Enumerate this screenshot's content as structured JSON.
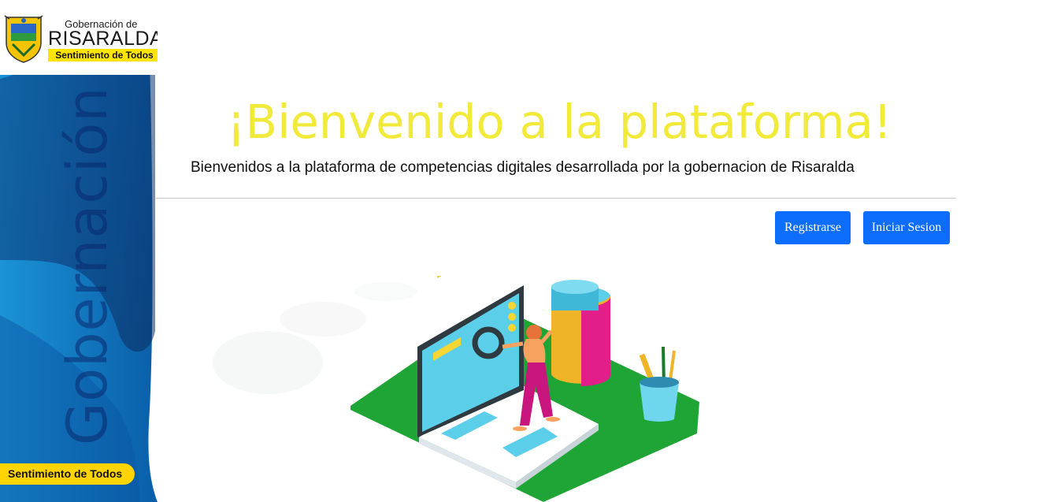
{
  "sidebar": {
    "logo": {
      "line1": "Gobernación de",
      "line2": "RISARALDA",
      "slogan": "Sentimiento de Todos"
    },
    "vertical_text": "Gobernación",
    "footer_pill": "Sentimiento de Todos"
  },
  "main": {
    "title": "¡Bienvenido a la plataforma!",
    "subtitle": "Bienvenidos a la plataforma de competencias digitales desarrollada por la gobernacion de Risaralda",
    "buttons": {
      "register": "Registrarse",
      "login": "Iniciar Sesion"
    }
  },
  "colors": {
    "title": "#f2ea3a",
    "button": "#0d6efd",
    "sidebar_blue": "#0a6fb8",
    "slogan_yellow": "#ffd400",
    "platform_green": "#1fa535"
  }
}
